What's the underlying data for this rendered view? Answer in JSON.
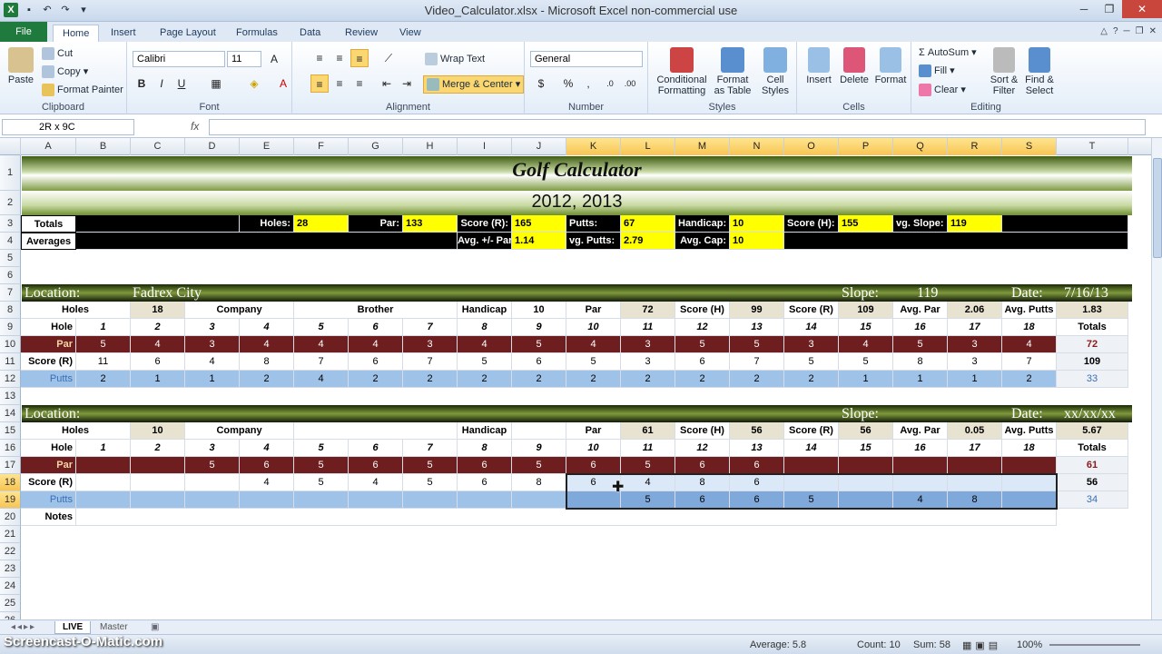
{
  "window": {
    "title": "Video_Calculator.xlsx - Microsoft Excel non-commercial use"
  },
  "tabs": [
    "File",
    "Home",
    "Insert",
    "Page Layout",
    "Formulas",
    "Data",
    "Review",
    "View"
  ],
  "ribbon": {
    "clipboard": {
      "label": "Clipboard",
      "paste": "Paste",
      "cut": "Cut",
      "copy": "Copy",
      "format_painter": "Format Painter"
    },
    "font": {
      "label": "Font",
      "name": "Calibri",
      "size": "11"
    },
    "alignment": {
      "label": "Alignment",
      "wrap": "Wrap Text",
      "merge": "Merge & Center"
    },
    "number": {
      "label": "Number",
      "format": "General"
    },
    "styles": {
      "label": "Styles",
      "cond1": "Conditional",
      "cond2": "Formatting",
      "fmt1": "Format",
      "fmt2": "as Table",
      "cell1": "Cell",
      "cell2": "Styles"
    },
    "cells": {
      "label": "Cells",
      "insert": "Insert",
      "delete": "Delete",
      "format": "Format"
    },
    "editing": {
      "label": "Editing",
      "autosum": "AutoSum",
      "fill": "Fill",
      "clear": "Clear",
      "sort1": "Sort &",
      "sort2": "Filter",
      "find1": "Find &",
      "find2": "Select"
    }
  },
  "formula_bar": {
    "name_box": "2R x 9C",
    "fx": "fx",
    "formula": ""
  },
  "columns": [
    "A",
    "B",
    "C",
    "D",
    "E",
    "F",
    "G",
    "H",
    "I",
    "J",
    "K",
    "L",
    "M",
    "N",
    "O",
    "P",
    "Q",
    "R",
    "S",
    "T"
  ],
  "rows": [
    "1",
    "2",
    "3",
    "4",
    "5",
    "6",
    "7",
    "8",
    "9",
    "10",
    "11",
    "12",
    "13",
    "14",
    "15",
    "16",
    "17",
    "18",
    "19",
    "20",
    "21",
    "22",
    "23",
    "24",
    "25",
    "26"
  ],
  "sheet": {
    "title": "Golf Calculator",
    "years": "2012, 2013",
    "totals_label": "Totals",
    "averages_label": "Averages",
    "holes_lbl": "Holes:",
    "holes_val": "28",
    "par_lbl": "Par:",
    "par_val": "133",
    "scorer_lbl": "Score (R):",
    "scorer_val": "165",
    "putts_lbl": "Putts:",
    "putts_val": "67",
    "hcap_lbl": "Handicap:",
    "hcap_val": "10",
    "scoreh_lbl": "Score (H):",
    "scoreh_val": "155",
    "slope_lbl": "vg. Slope:",
    "slope_val": "119",
    "avgpar_lbl": "Avg. +/- Par:",
    "avgpar_val": "1.14",
    "avgputts_lbl": "vg. Putts:",
    "avgputts_val": "2.79",
    "avgcap_lbl": "Avg. Cap:",
    "avgcap_val": "10",
    "r1": {
      "loc": "Location:",
      "locname": "Fadrex City",
      "slope": "Slope:",
      "slopev": "119",
      "date": "Date:",
      "datev": "7/16/13",
      "holes": "Holes",
      "holesv": "18",
      "company": "Company",
      "companyv": "Brother",
      "hcap": "Handicap",
      "hcapv": "10",
      "par": "Par",
      "parv": "72",
      "sh": "Score (H)",
      "shv": "99",
      "sr": "Score (R)",
      "srv": "109",
      "ap": "Avg. Par",
      "apv": "2.06",
      "aputts": "Avg. Putts",
      "aputtsv": "1.83",
      "hole": "Hole",
      "totals": "Totals",
      "pars": [
        "5",
        "4",
        "3",
        "4",
        "4",
        "4",
        "3",
        "4",
        "5",
        "4",
        "3",
        "5",
        "5",
        "3",
        "4",
        "5",
        "3",
        "4",
        "72"
      ],
      "scores": [
        "11",
        "6",
        "4",
        "8",
        "7",
        "6",
        "7",
        "5",
        "6",
        "5",
        "3",
        "6",
        "7",
        "5",
        "5",
        "8",
        "3",
        "7",
        "109"
      ],
      "putts": [
        "2",
        "1",
        "1",
        "2",
        "4",
        "2",
        "2",
        "2",
        "2",
        "2",
        "2",
        "2",
        "2",
        "2",
        "1",
        "1",
        "1",
        "2",
        "33"
      ]
    },
    "r2": {
      "loc": "Location:",
      "slope": "Slope:",
      "date": "Date:",
      "datev": "xx/xx/xx",
      "holes": "Holes",
      "holesv": "10",
      "company": "Company",
      "hcap": "Handicap",
      "par": "Par",
      "parv": "61",
      "sh": "Score (H)",
      "shv": "56",
      "sr": "Score (R)",
      "srv": "56",
      "ap": "Avg. Par",
      "apv": "0.05",
      "aputts": "Avg. Putts",
      "aputtsv": "5.67",
      "hole": "Hole",
      "totals": "Totals",
      "notes": "Notes",
      "pars": [
        "",
        "",
        "5",
        "6",
        "5",
        "6",
        "5",
        "6",
        "5",
        "6",
        "5",
        "6",
        "6",
        "",
        "",
        "",
        "",
        "",
        "61"
      ],
      "scores": [
        "",
        "",
        "",
        "4",
        "5",
        "4",
        "5",
        "6",
        "8",
        "6",
        "4",
        "8",
        "6",
        "",
        "",
        "",
        "",
        "",
        "56"
      ],
      "putts": [
        "",
        "",
        "",
        "",
        "",
        "",
        "",
        "",
        "",
        "",
        "5",
        "6",
        "6",
        "5",
        "",
        "4",
        "8",
        "",
        "34"
      ]
    },
    "hole_nums": [
      "1",
      "2",
      "3",
      "4",
      "5",
      "6",
      "7",
      "8",
      "9",
      "10",
      "11",
      "12",
      "13",
      "14",
      "15",
      "16",
      "17",
      "18"
    ],
    "par_label": "Par",
    "score_label": "Score (R)",
    "putts_label": "Putts"
  },
  "sheet_tabs": [
    "LIVE",
    "Master"
  ],
  "status": {
    "average": "Average: 5.8",
    "count": "Count: 10",
    "sum": "Sum: 58",
    "zoom": "100%"
  },
  "watermark": "Screencast-O-Matic.com",
  "colors": {
    "par_row": "#6e1e1e",
    "putts_row": "#9fc2e8",
    "highlight": "#ffff00",
    "accent": "#1e7b3d"
  }
}
